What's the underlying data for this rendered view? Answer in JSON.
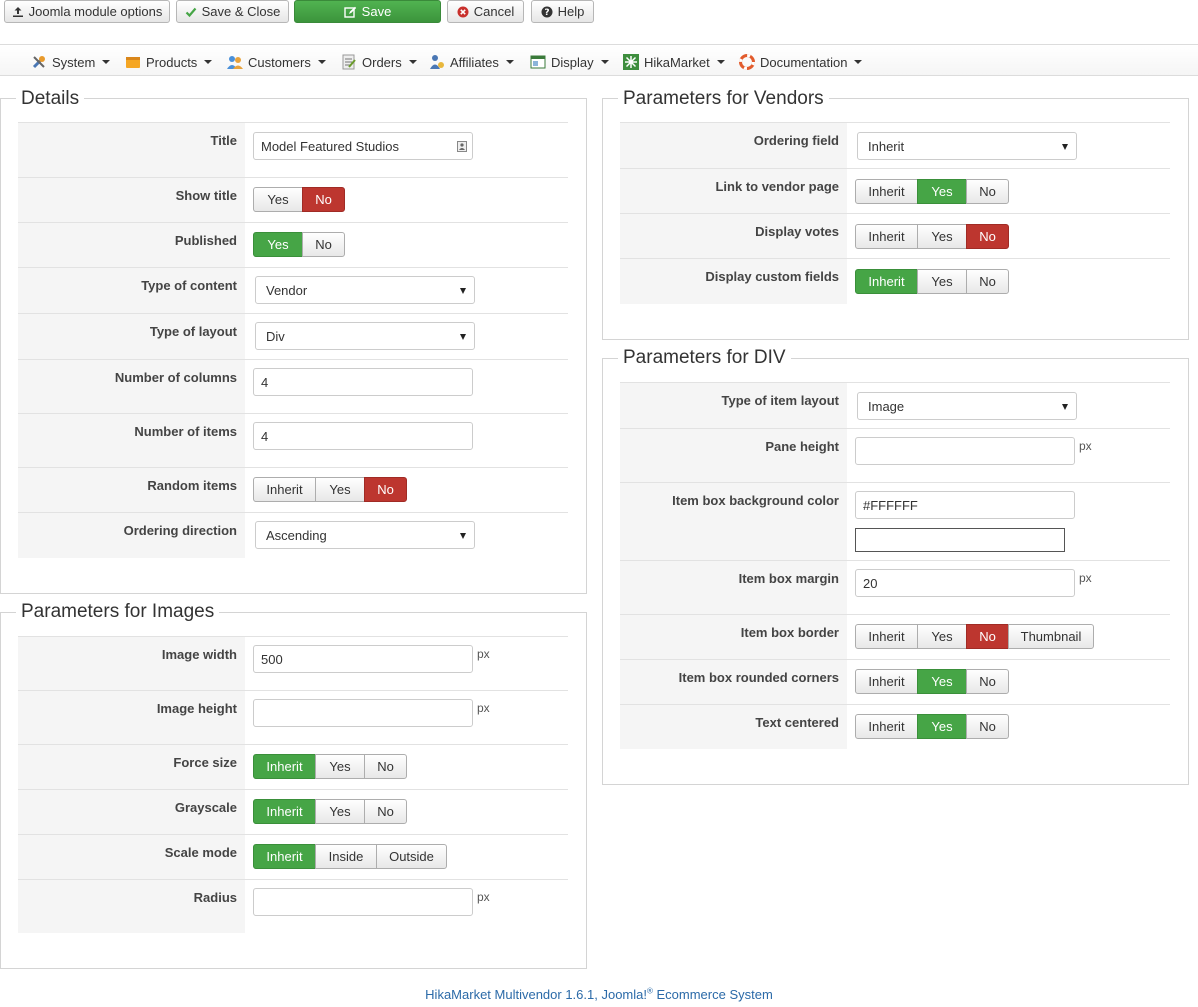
{
  "toolbar": {
    "options_label": "Joomla module options",
    "save_close_label": "Save & Close",
    "save_label": "Save",
    "cancel_label": "Cancel",
    "help_label": "Help"
  },
  "menu": {
    "system": "System",
    "products": "Products",
    "customers": "Customers",
    "orders": "Orders",
    "affiliates": "Affiliates",
    "display": "Display",
    "hikamarket": "HikaMarket",
    "documentation": "Documentation"
  },
  "details": {
    "legend": "Details",
    "title_label": "Title",
    "title_value": "Model Featured Studios",
    "show_title_label": "Show title",
    "show_title_options": [
      "Yes",
      "No"
    ],
    "show_title_selected": "No",
    "published_label": "Published",
    "published_options": [
      "Yes",
      "No"
    ],
    "published_selected": "Yes",
    "type_content_label": "Type of content",
    "type_content_value": "Vendor",
    "type_layout_label": "Type of layout",
    "type_layout_value": "Div",
    "columns_label": "Number of columns",
    "columns_value": "4",
    "items_label": "Number of items",
    "items_value": "4",
    "random_label": "Random items",
    "random_options": [
      "Inherit",
      "Yes",
      "No"
    ],
    "random_selected": "No",
    "ordering_label": "Ordering direction",
    "ordering_value": "Ascending"
  },
  "images": {
    "legend": "Parameters for Images",
    "width_label": "Image width",
    "width_value": "500",
    "height_label": "Image height",
    "height_value": "",
    "unit": "px",
    "force_label": "Force size",
    "force_options": [
      "Inherit",
      "Yes",
      "No"
    ],
    "force_selected": "Inherit",
    "grayscale_label": "Grayscale",
    "grayscale_options": [
      "Inherit",
      "Yes",
      "No"
    ],
    "grayscale_selected": "Inherit",
    "scale_label": "Scale mode",
    "scale_options": [
      "Inherit",
      "Inside",
      "Outside"
    ],
    "scale_selected": "Inherit",
    "radius_label": "Radius",
    "radius_value": ""
  },
  "vendors": {
    "legend": "Parameters for Vendors",
    "ordering_label": "Ordering field",
    "ordering_value": "Inherit",
    "link_label": "Link to vendor page",
    "link_options": [
      "Inherit",
      "Yes",
      "No"
    ],
    "link_selected": "Yes",
    "votes_label": "Display votes",
    "votes_options": [
      "Inherit",
      "Yes",
      "No"
    ],
    "votes_selected": "No",
    "custom_label": "Display custom fields",
    "custom_options": [
      "Inherit",
      "Yes",
      "No"
    ],
    "custom_selected": "Inherit"
  },
  "div": {
    "legend": "Parameters for DIV",
    "item_layout_label": "Type of item layout",
    "item_layout_value": "Image",
    "pane_label": "Pane height",
    "pane_value": "",
    "bg_label": "Item box background color",
    "bg_value": "#FFFFFF",
    "margin_label": "Item box margin",
    "margin_value": "20",
    "border_label": "Item box border",
    "border_options": [
      "Inherit",
      "Yes",
      "No",
      "Thumbnail"
    ],
    "border_selected": "No",
    "rounded_label": "Item box rounded corners",
    "rounded_options": [
      "Inherit",
      "Yes",
      "No"
    ],
    "rounded_selected": "Yes",
    "centered_label": "Text centered",
    "centered_options": [
      "Inherit",
      "Yes",
      "No"
    ],
    "centered_selected": "Yes"
  },
  "footer": {
    "text": "HikaMarket Multivendor 1.6.1, Joomla!",
    "reg": "®",
    "suffix": " Ecommerce System"
  },
  "colors": {
    "active_green": "#46a546",
    "active_red": "#bd362f",
    "link_blue": "#2b6aa8"
  }
}
